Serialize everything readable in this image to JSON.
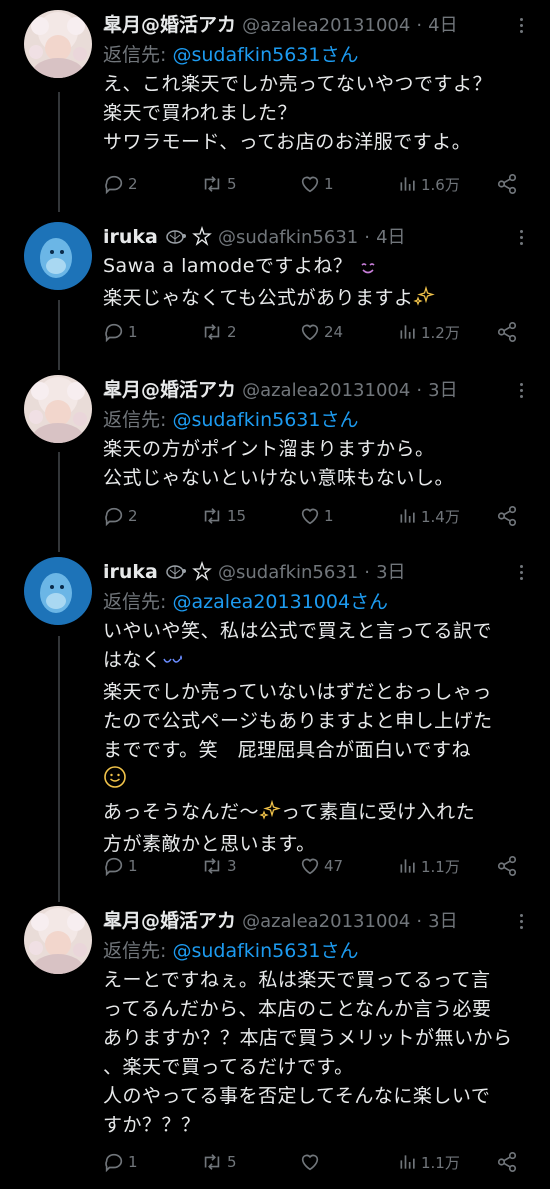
{
  "tweets": [
    {
      "name": "皐月@婚活アカ",
      "handle": "@azalea20131004",
      "dot": "·",
      "time": "4日",
      "reply_label": "返信先:",
      "reply_target": "@sudafkin5631さん",
      "lines": [
        "え、これ楽天でしか売ってないやつですよ？",
        "楽天で買われました？",
        "サワラモード、ってお店のお洋服ですよ。"
      ],
      "replies": "2",
      "retweets": "5",
      "likes": "1",
      "views": "1.6万"
    },
    {
      "name": "iruka",
      "handle": "@sudafkin5631",
      "dot": "·",
      "time": "4日",
      "lines": [
        "Sawa a lamodeですよね？",
        "楽天じゃなくても公式がありますよ"
      ],
      "replies": "1",
      "retweets": "2",
      "likes": "24",
      "views": "1.2万"
    },
    {
      "name": "皐月@婚活アカ",
      "handle": "@azalea20131004",
      "dot": "·",
      "time": "3日",
      "reply_label": "返信先:",
      "reply_target": "@sudafkin5631さん",
      "lines": [
        "楽天の方がポイント溜まりますから。",
        "公式じゃないといけない意味もないし。"
      ],
      "replies": "2",
      "retweets": "15",
      "likes": "1",
      "views": "1.4万"
    },
    {
      "name": "iruka",
      "handle": "@sudafkin5631",
      "dot": "·",
      "time": "3日",
      "reply_label": "返信先:",
      "reply_target": "@azalea20131004さん",
      "lines": [
        "いやいや笑、私は公式で買えと言ってる訳で",
        "はなく",
        "楽天でしか売っていないはずだとおっしゃっ",
        "たので公式ページもありますよと申し上げた",
        "までです。笑　屁理屈具合が面白いですね",
        "",
        "あっそうなんだ〜",
        "方が素敵かと思います。"
      ],
      "line6_suffix": "って素直に受け入れた",
      "replies": "1",
      "retweets": "3",
      "likes": "47",
      "views": "1.1万"
    },
    {
      "name": "皐月@婚活アカ",
      "handle": "@azalea20131004",
      "dot": "·",
      "time": "3日",
      "reply_label": "返信先:",
      "reply_target": "@sudafkin5631さん",
      "lines": [
        "えーとですねぇ。私は楽天で買ってるって言",
        "ってるんだから、本店のことなんか言う必要",
        "ありますか？？本店で買うメリットが無いから",
        "、楽天で買ってるだけです。",
        "人のやってる事を否定してそんなに楽しいで",
        "すか？？？"
      ],
      "replies": "1",
      "retweets": "5",
      "likes": "",
      "views": "1.1万"
    }
  ],
  "icons": {
    "reply": "reply-icon",
    "retweet": "retweet-icon",
    "like": "heart-icon",
    "views": "views-icon",
    "share": "share-icon",
    "more": "more-icon"
  },
  "colors": {
    "background": "#000000",
    "text": "#e7e9ea",
    "muted": "#71767b",
    "link": "#1d9bf0"
  }
}
